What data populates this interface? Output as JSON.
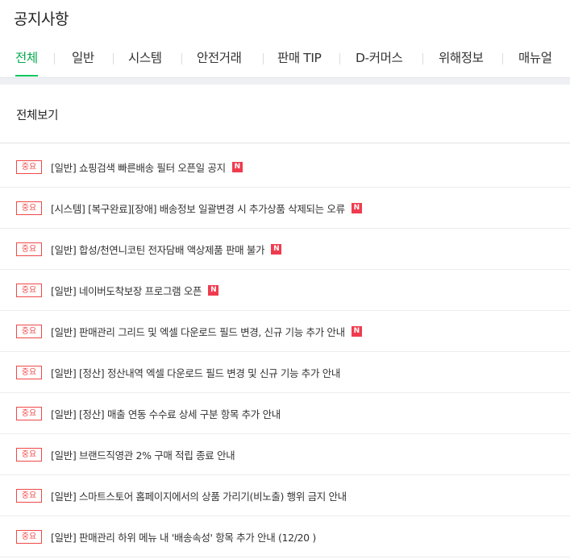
{
  "page": {
    "title": "공지사항"
  },
  "tabs": [
    {
      "label": "전체",
      "active": true
    },
    {
      "label": "일반"
    },
    {
      "label": "시스템"
    },
    {
      "label": "안전거래"
    },
    {
      "label": "판매 TIP"
    },
    {
      "label": "D-커머스"
    },
    {
      "label": "위해정보"
    },
    {
      "label": "매뉴얼"
    }
  ],
  "section": {
    "title": "전체보기"
  },
  "badge_label": "중요",
  "new_label": "N",
  "notices": [
    {
      "title": "[일반] 쇼핑검색 빠른배송 필터 오픈일 공지",
      "is_new": true
    },
    {
      "title": "[시스템] [복구완료][장애] 배송정보 일괄변경 시 추가상품 삭제되는 오류",
      "is_new": true
    },
    {
      "title": "[일반] 합성/천연니코틴 전자담배 액상제품 판매 불가",
      "is_new": true
    },
    {
      "title": "[일반] 네이버도착보장 프로그램 오픈",
      "is_new": true
    },
    {
      "title": "[일반] 판매관리 그리드 및 엑셀 다운로드 필드 변경, 신규 기능 추가 안내",
      "is_new": true
    },
    {
      "title": "[일반] [정산] 정산내역 엑셀 다운로드 필드 변경 및 신규 기능 추가 안내",
      "is_new": false
    },
    {
      "title": "[일반] [정산] 매출 연동 수수료 상세 구분 항목 추가 안내",
      "is_new": false
    },
    {
      "title": "[일반] 브랜드직영관 2% 구매 적립 종료 안내",
      "is_new": false
    },
    {
      "title": "[일반] 스마트스토어 홈페이지에서의 상품 가리기(비노출) 행위 금지 안내",
      "is_new": false
    },
    {
      "title": "[일반] 판매관리 하위 메뉴 내 '배송속성' 항목 추가 안내 (12/20 )",
      "is_new": false
    }
  ],
  "colors": {
    "accent_green": "#03c75a",
    "badge_red": "#f04848",
    "new_red": "#f03b4f"
  }
}
